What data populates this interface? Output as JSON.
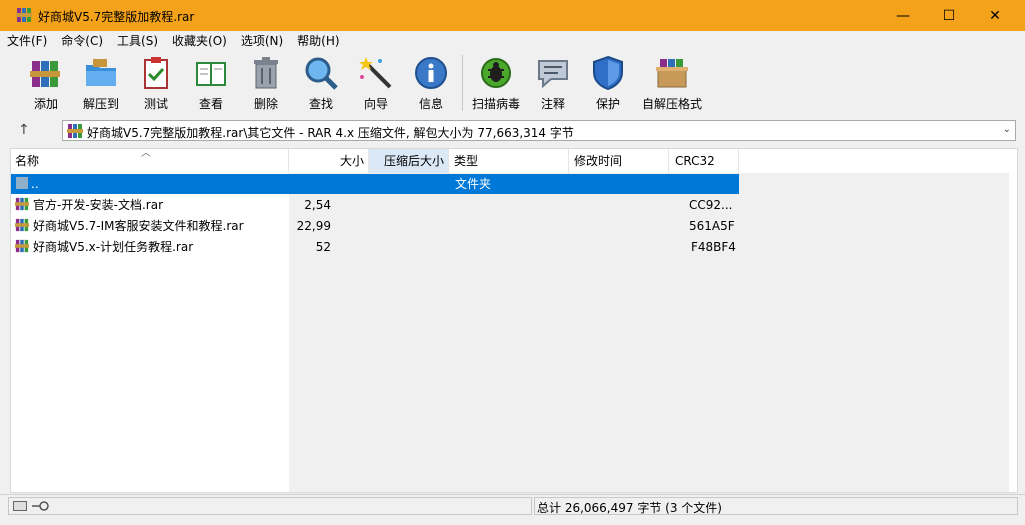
{
  "window": {
    "title": "好商城V5.7完整版加教程.rar",
    "minimize": "—",
    "maximize": "☐",
    "close": "✕"
  },
  "menu": [
    "文件(F)",
    "命令(C)",
    "工具(S)",
    "收藏夹(O)",
    "选项(N)",
    "帮助(H)"
  ],
  "toolbar": {
    "add": "添加",
    "extract": "解压到",
    "test": "测试",
    "view": "查看",
    "delete": "删除",
    "find": "查找",
    "wizard": "向导",
    "info": "信息",
    "scan": "扫描病毒",
    "comment": "注释",
    "protect": "保护",
    "sfx": "自解压格式"
  },
  "address": {
    "up": "↑",
    "path": "好商城V5.7完整版加教程.rar\\其它文件 - RAR 4.x 压缩文件, 解包大小为 77,663,314 字节",
    "dropdown": "⌄"
  },
  "columns": {
    "name": "名称",
    "size": "大小",
    "packed": "压缩后大小",
    "type": "类型",
    "modified": "修改时间",
    "crc": "CRC32"
  },
  "parent_row": {
    "name": "..",
    "type": "文件夹"
  },
  "files": [
    {
      "name": "官方-开发-安装-文档.rar",
      "size": "2,54",
      "crc": "CC92..."
    },
    {
      "name": "好商城V5.7-IM客服安装文件和教程.rar",
      "size": "22,99",
      "crc": "561A5F"
    },
    {
      "name": "好商城V5.x-计划任务教程.rar",
      "size": "52",
      "crc": "F48BF4"
    }
  ],
  "status": {
    "total": "总计 26,066,497 字节 (3 个文件)"
  }
}
